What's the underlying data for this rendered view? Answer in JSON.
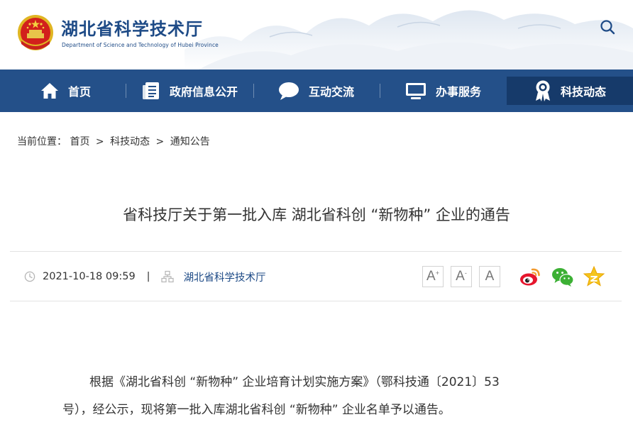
{
  "site": {
    "name": "湖北省科学技术厅",
    "subtitle": "Department of Science and Technology of Hubei Province"
  },
  "icons": {
    "search": "search-icon",
    "home": "home-icon",
    "document": "document-list-icon",
    "chat": "chat-bubble-icon",
    "monitor": "monitor-icon",
    "award": "award-ribbon-icon",
    "clock": "clock-icon",
    "source": "org-chart-icon",
    "weibo": "weibo-icon",
    "wechat": "wechat-icon",
    "favorite": "star-icon"
  },
  "colors": {
    "brand": "#245089",
    "nav_active": "#163a6a",
    "text": "#333333",
    "link": "#1d4a86"
  },
  "nav": {
    "items": [
      {
        "label": "首页"
      },
      {
        "label": "政府信息公开"
      },
      {
        "label": "互动交流"
      },
      {
        "label": "办事服务"
      },
      {
        "label": "科技动态",
        "active": true
      }
    ]
  },
  "breadcrumb": {
    "prefix": "当前位置：",
    "items": [
      "首页",
      "科技动态",
      "通知公告"
    ],
    "separator": ">"
  },
  "article": {
    "title": "省科技厅关于第一批入库 湖北省科创 “新物种” 企业的通告",
    "datetime": "2021-10-18 09:59",
    "divider": "|",
    "source": "湖北省科学技术厅",
    "font_buttons": {
      "large": "A",
      "large_mark": "+",
      "small": "A",
      "small_mark": "-",
      "normal": "A"
    },
    "body_lines": [
      "根据《湖北省科创 “新物种” 企业培育计划实施方案》（鄂科技通〔2021〕53",
      "号），经公示，现将第一批入库湖北省科创 “新物种” 企业名单予以通告。"
    ]
  }
}
